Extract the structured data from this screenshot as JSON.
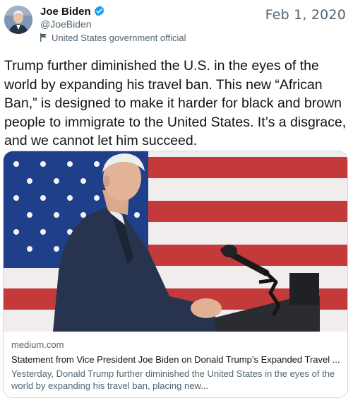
{
  "author": {
    "name": "Joe Biden",
    "handle": "@JoeBiden",
    "label": "United States government official",
    "verified": true,
    "avatar_icon": "profile-photo"
  },
  "date": "Feb 1, 2020",
  "text": "Trump further diminished the U.S. in the eyes of the world by expanding his travel ban. This new “African Ban,” is designed to make it harder for black and brown people to immigrate to the United States. It’s a disgrace, and we cannot let him succeed.",
  "card": {
    "domain": "medium.com",
    "title": "Statement from Vice President Joe Biden on Donald Trump’s Expanded Travel ...",
    "description": "Yesterday, Donald Trump further diminished the United States in the eyes of the world by expanding his travel ban, placing new...",
    "image_icon": "speaker-at-podium-with-flag"
  },
  "colors": {
    "text": "#0f1419",
    "secondary": "#536471",
    "verified": "#1d9bf0",
    "border": "#cfd9de"
  }
}
